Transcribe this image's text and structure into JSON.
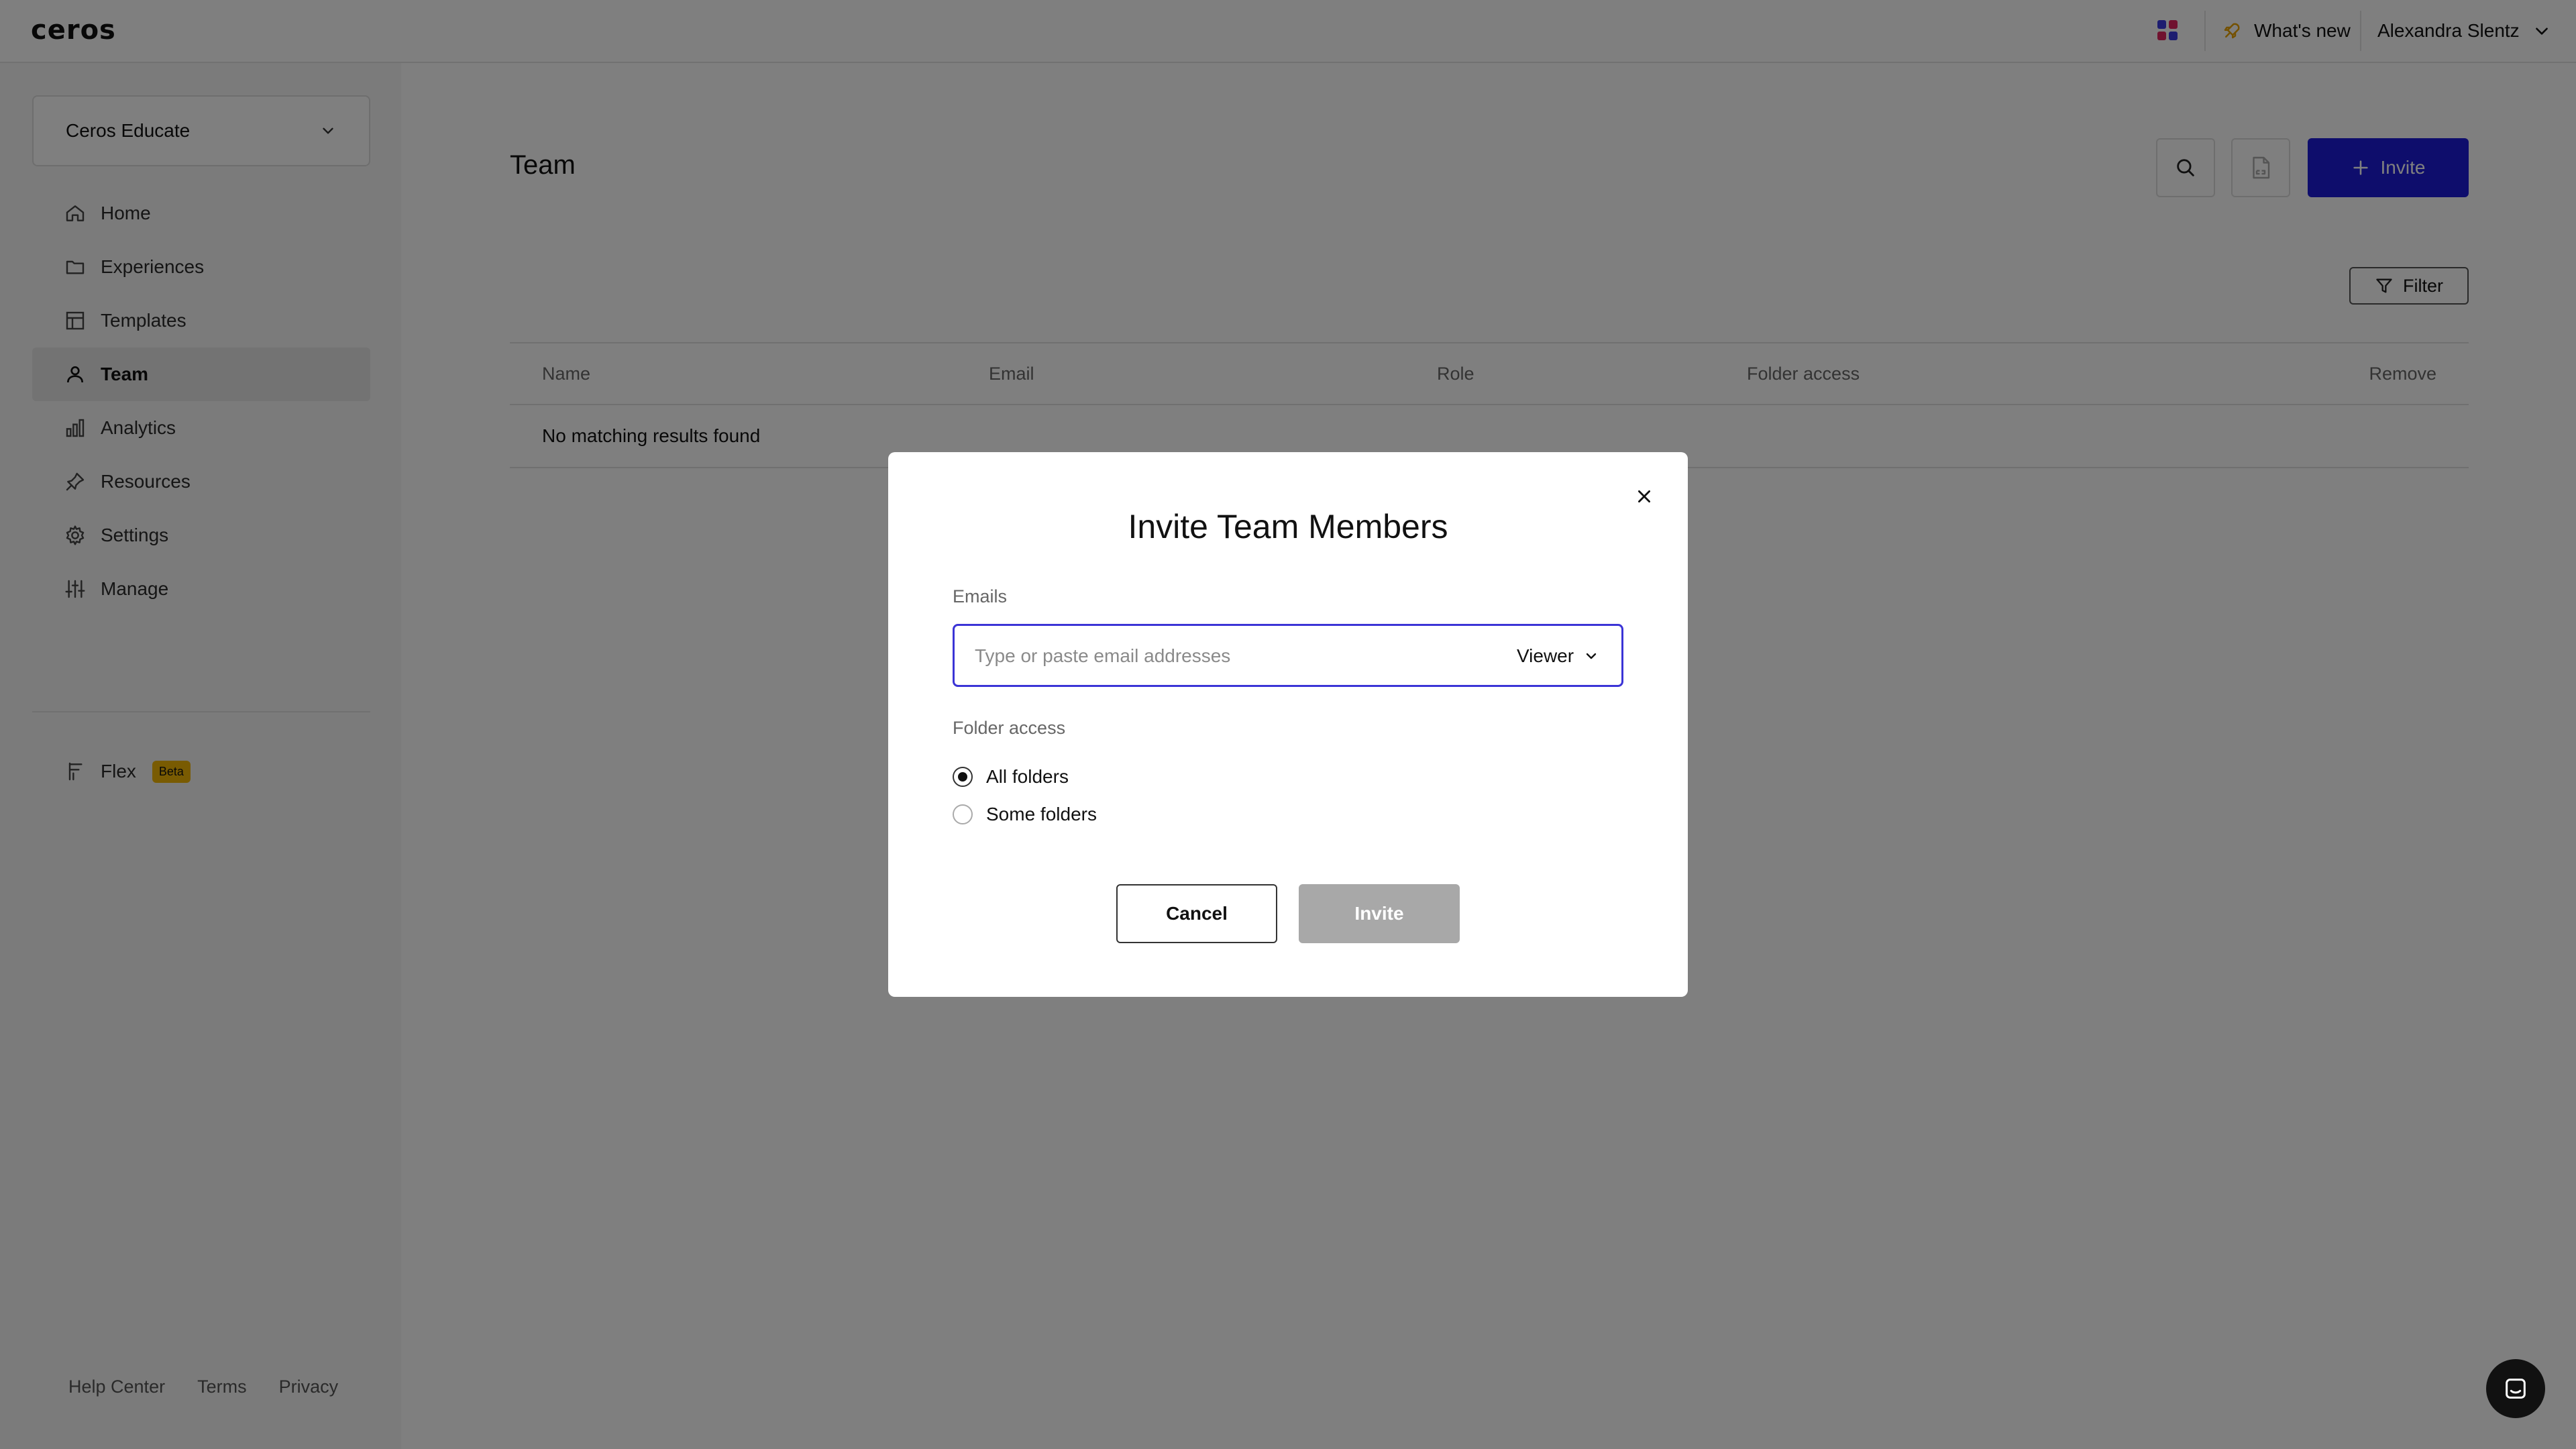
{
  "topbar": {
    "logo": "ceros",
    "apps_icon": "apps-grid-icon",
    "apps_colors": [
      "#3a3ae0",
      "#e0245e",
      "#e0245e",
      "#3a3ae0"
    ],
    "whats_new_icon": "rocket-icon",
    "whats_new_label": "What's new",
    "user_name": "Alexandra Slentz"
  },
  "sidebar": {
    "workspace": "Ceros Educate",
    "items": [
      {
        "label": "Home",
        "icon": "home-icon"
      },
      {
        "label": "Experiences",
        "icon": "folder-icon"
      },
      {
        "label": "Templates",
        "icon": "template-icon"
      },
      {
        "label": "Team",
        "icon": "person-icon",
        "active": true
      },
      {
        "label": "Analytics",
        "icon": "bar-chart-icon"
      },
      {
        "label": "Resources",
        "icon": "pin-icon"
      },
      {
        "label": "Settings",
        "icon": "gear-icon"
      },
      {
        "label": "Manage",
        "icon": "sliders-icon"
      }
    ],
    "flex": {
      "label": "Flex",
      "badge": "Beta",
      "icon": "flex-icon"
    },
    "footer": [
      "Help Center",
      "Terms",
      "Privacy"
    ]
  },
  "main": {
    "title": "Team",
    "invite_label": "Invite",
    "filter_label": "Filter",
    "table": {
      "columns": [
        "Name",
        "Email",
        "Role",
        "Folder access",
        "Remove"
      ],
      "empty_message": "No matching results found"
    }
  },
  "modal": {
    "title": "Invite Team Members",
    "emails_label": "Emails",
    "email_placeholder": "Type or paste email addresses",
    "role_value": "Viewer",
    "folder_access_label": "Folder access",
    "options": [
      {
        "label": "All folders",
        "selected": true
      },
      {
        "label": "Some folders",
        "selected": false
      }
    ],
    "cancel_label": "Cancel",
    "invite_label": "Invite"
  },
  "colors": {
    "accent": "#1c1ad8",
    "input_focus": "#3b34d6",
    "beta_badge": "#f2b705",
    "disabled_button": "#a8a8a8"
  }
}
